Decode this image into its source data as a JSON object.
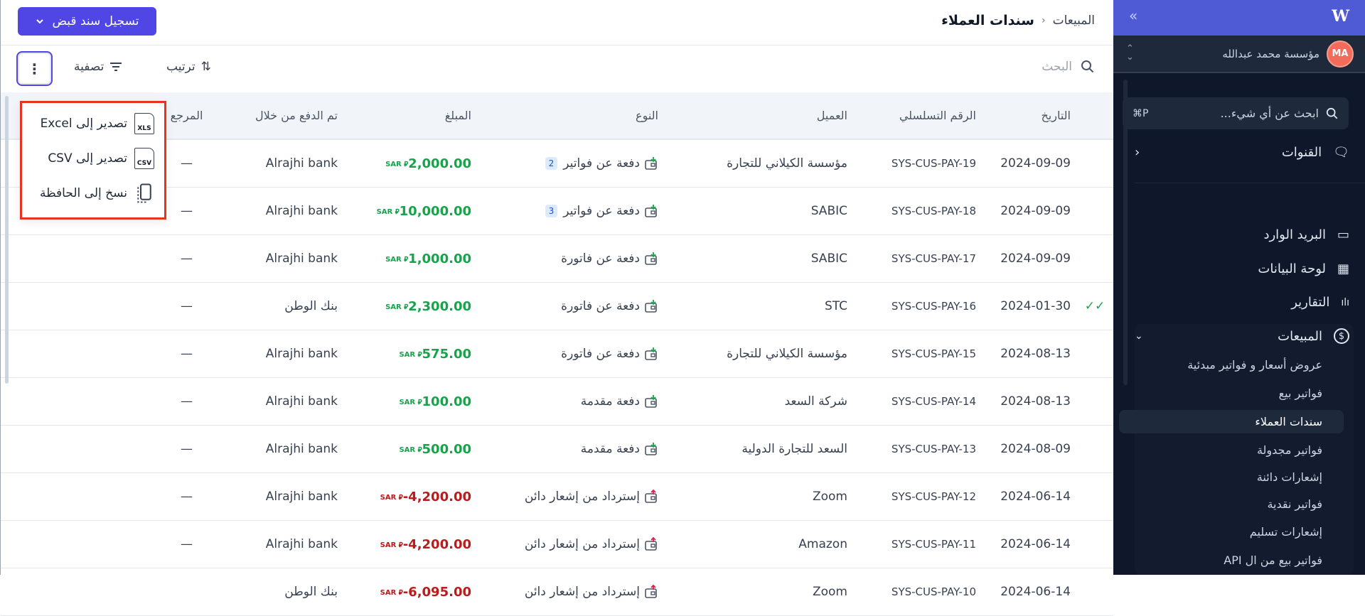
{
  "header": {
    "breadcrumb_parent": "المبيعات",
    "title": "سندات العملاء",
    "primary_button": "تسجيل سند قبض"
  },
  "toolbar": {
    "search_placeholder": "البحث",
    "sort_label": "ترتيب",
    "filter_label": "تصفية"
  },
  "table": {
    "columns": [
      "التاريخ",
      "الرقم التسلسلي",
      "العميل",
      "النوع",
      "المبلغ",
      "تم الدفع من خلال",
      "المرجع"
    ],
    "rows": [
      {
        "date": "2024-09-09",
        "serial": "SYS-CUS-PAY-19",
        "client": "مؤسسة الكيلاني للتجارة",
        "type": "دفعة عن فواتير",
        "direction": "in",
        "badge": "2",
        "amount": "2,000.00",
        "currency": "SAR",
        "paid_via": "Alrajhi bank",
        "ref": "—",
        "status": ""
      },
      {
        "date": "2024-09-09",
        "serial": "SYS-CUS-PAY-18",
        "client": "SABIC",
        "type": "دفعة عن فواتير",
        "direction": "in",
        "badge": "3",
        "amount": "10,000.00",
        "currency": "SAR",
        "paid_via": "Alrajhi bank",
        "ref": "—",
        "status": ""
      },
      {
        "date": "2024-09-09",
        "serial": "SYS-CUS-PAY-17",
        "client": "SABIC",
        "type": "دفعة عن فاتورة",
        "direction": "in",
        "badge": "",
        "amount": "1,000.00",
        "currency": "SAR",
        "paid_via": "Alrajhi bank",
        "ref": "—",
        "status": ""
      },
      {
        "date": "2024-01-30",
        "serial": "SYS-CUS-PAY-16",
        "client": "STC",
        "type": "دفعة عن فاتورة",
        "direction": "in",
        "badge": "",
        "amount": "2,300.00",
        "currency": "SAR",
        "paid_via": "بنك الوطن",
        "ref": "—",
        "status": "double-check"
      },
      {
        "date": "2024-08-13",
        "serial": "SYS-CUS-PAY-15",
        "client": "مؤسسة الكيلاني للتجارة",
        "type": "دفعة عن فاتورة",
        "direction": "in",
        "badge": "",
        "amount": "575.00",
        "currency": "SAR",
        "paid_via": "Alrajhi bank",
        "ref": "—",
        "status": ""
      },
      {
        "date": "2024-08-13",
        "serial": "SYS-CUS-PAY-14",
        "client": "شركة السعد",
        "type": "دفعة مقدمة",
        "direction": "in",
        "badge": "",
        "amount": "100.00",
        "currency": "SAR",
        "paid_via": "Alrajhi bank",
        "ref": "—",
        "status": ""
      },
      {
        "date": "2024-08-09",
        "serial": "SYS-CUS-PAY-13",
        "client": "السعد للتجارة الدولية",
        "type": "دفعة مقدمة",
        "direction": "in",
        "badge": "",
        "amount": "500.00",
        "currency": "SAR",
        "paid_via": "Alrajhi bank",
        "ref": "—",
        "status": ""
      },
      {
        "date": "2024-06-14",
        "serial": "SYS-CUS-PAY-12",
        "client": "Zoom",
        "type": "إسترداد من إشعار دائن",
        "direction": "out",
        "badge": "",
        "amount": "-4,200.00",
        "currency": "SAR",
        "paid_via": "Alrajhi bank",
        "ref": "—",
        "status": ""
      },
      {
        "date": "2024-06-14",
        "serial": "SYS-CUS-PAY-11",
        "client": "Amazon",
        "type": "إسترداد من إشعار دائن",
        "direction": "out",
        "badge": "",
        "amount": "-4,200.00",
        "currency": "SAR",
        "paid_via": "Alrajhi bank",
        "ref": "—",
        "status": ""
      },
      {
        "date": "2024-06-14",
        "serial": "SYS-CUS-PAY-10",
        "client": "Zoom",
        "type": "إسترداد من إشعار دائن",
        "direction": "out",
        "badge": "",
        "amount": "-6,095.00",
        "currency": "SAR",
        "paid_via": "بنك الوطن",
        "ref": "",
        "status": ""
      }
    ]
  },
  "menu": {
    "items": [
      "تصدير إلى Excel",
      "تصدير إلى CSV",
      "نسخ إلى الحافظة"
    ],
    "icon_labels": [
      "XLS",
      "CSV"
    ]
  },
  "sidebar": {
    "org_name": "مؤسسة محمد عبدالله",
    "avatar_initials": "MA",
    "search_placeholder": "ابحث عن أي شيء...",
    "search_shortcut": "⌘P",
    "channels": "القنوات",
    "inbox": "البريد الوارد",
    "dashboard": "لوحة البيانات",
    "reports": "التقارير",
    "sales": "المبيعات",
    "sales_items": [
      "عروض أسعار و فواتير مبدئية",
      "فواتير بيع",
      "سندات العملاء",
      "فواتير مجدولة",
      "إشعارات دائنة",
      "فواتير نقدية",
      "إشعارات تسليم",
      "فواتير بيع من ال API"
    ],
    "active_index": 2
  },
  "colors": {
    "accent": "#4f46e5",
    "positive": "#16a34a",
    "negative": "#b91c1c",
    "sidebar_bg": "#0f172a",
    "sidebar_top": "#4f5bd5"
  }
}
